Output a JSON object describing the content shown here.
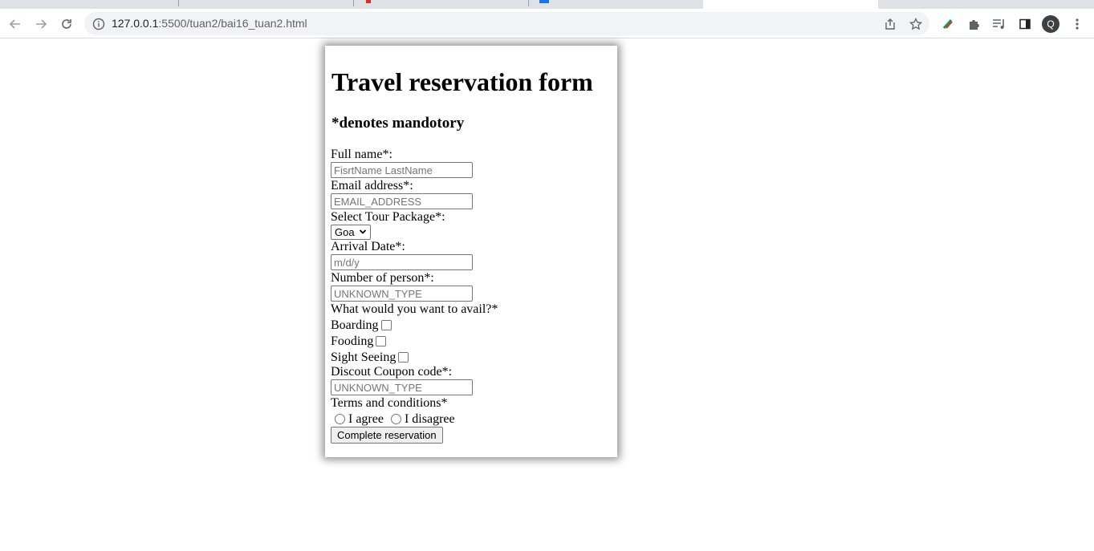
{
  "browser": {
    "url_host": "127.0.0.1",
    "url_rest": ":5500/tuan2/bai16_tuan2.html",
    "profile_initial": "Q"
  },
  "form": {
    "title": "Travel reservation form",
    "subtitle": "*denotes mandotory",
    "full_name_label": "Full name*:",
    "full_name_placeholder": "FisrtName LastName",
    "email_label": "Email address*:",
    "email_placeholder": "EMAIL_ADDRESS",
    "package_label": "Select Tour Package*:",
    "package_selected": "Goa",
    "arrival_label": "Arrival Date*:",
    "arrival_placeholder": "m/d/y",
    "persons_label": "Number of person*:",
    "persons_placeholder": "UNKNOWN_TYPE",
    "avail_label": "What would you want to avail?*",
    "options": [
      "Boarding",
      "Fooding",
      "Sight Seeing"
    ],
    "coupon_label": "Discout Coupon code*:",
    "coupon_placeholder": "UNKNOWN_TYPE",
    "terms_label": "Terms and conditions*",
    "agree_label": "I agree",
    "disagree_label": "I disagree",
    "submit_label": "Complete reservation"
  }
}
